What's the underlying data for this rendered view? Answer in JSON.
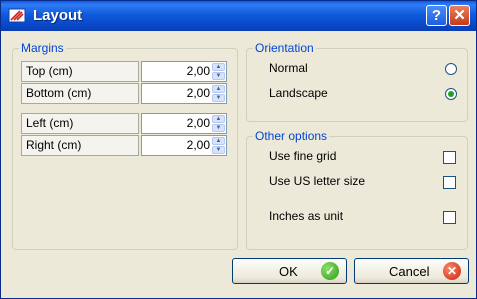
{
  "window": {
    "title": "Layout",
    "help_label": "?",
    "close_label": "✕"
  },
  "margins": {
    "title": "Margins",
    "rows": [
      {
        "label": "Top (cm)",
        "value": "2,00"
      },
      {
        "label": "Bottom (cm)",
        "value": "2,00"
      },
      {
        "label": "Left (cm)",
        "value": "2,00"
      },
      {
        "label": "Right (cm)",
        "value": "2,00"
      }
    ]
  },
  "orientation": {
    "title": "Orientation",
    "options": [
      {
        "label": "Normal",
        "selected": false
      },
      {
        "label": "Landscape",
        "selected": true
      }
    ]
  },
  "other_options": {
    "title": "Other options",
    "items": [
      {
        "label": "Use fine grid",
        "checked": false
      },
      {
        "label": "Use US letter size",
        "checked": false
      },
      {
        "label": "Inches as unit",
        "checked": false
      }
    ]
  },
  "buttons": {
    "ok": "OK",
    "cancel": "Cancel"
  },
  "icons": {
    "app": "layout-app-icon",
    "ok": "check-icon",
    "cancel": "cancel-icon",
    "spin_up": "up-arrow-icon",
    "spin_down": "down-arrow-icon"
  },
  "colors": {
    "title_bar": "#0a5ae6",
    "group_title": "#0046d5",
    "dialog_bg": "#ece9d8",
    "radio_selected": "#21a121"
  }
}
